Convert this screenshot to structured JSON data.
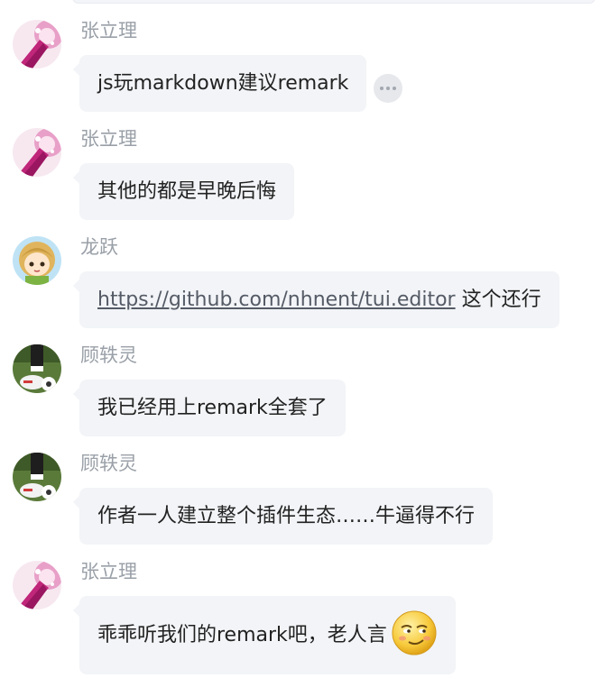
{
  "messages": [
    {
      "sender": "张立理",
      "text": "js玩markdown建议remark"
    },
    {
      "sender": "张立理",
      "text": "其他的都是早晚后悔"
    },
    {
      "sender": "龙跃",
      "link": "https://github.com/nhnent/tui.editor",
      "text": " 这个还行"
    },
    {
      "sender": "顾轶灵",
      "text": "我已经用上remark全套了"
    },
    {
      "sender": "顾轶灵",
      "text": "作者一人建立整个插件生态……牛逼得不行"
    },
    {
      "sender": "张立理",
      "text": "乖乖听我们的remark吧，老人言"
    }
  ],
  "icons": {
    "more": "more-horizontal-icon",
    "emoji": "smirk-emoji-icon"
  },
  "colors": {
    "bubble_bg": "#f2f4f7",
    "sender_name": "#9aa0a8",
    "message_text": "#222222",
    "link_text": "#555b66"
  }
}
